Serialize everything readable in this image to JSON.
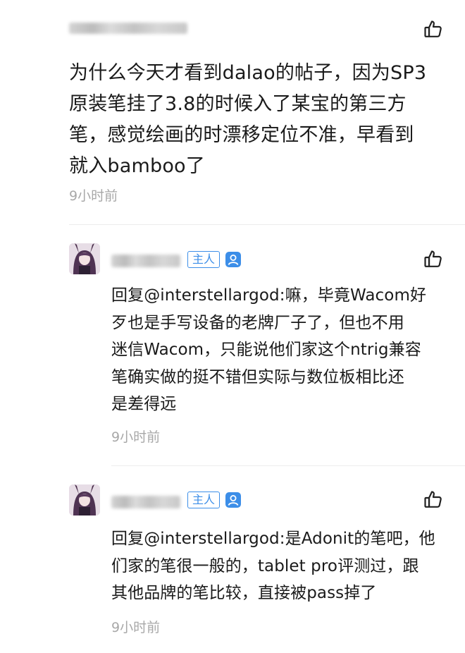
{
  "comments": [
    {
      "author_masked": true,
      "text": "为什么今天才看到dalao的帖子，因为SP3\n原装笔挂了3.8的时候入了某宝的第三方\n笔，感觉绘画的时漂移定位不准，早看到\n就入bamboo了",
      "time": "9小时前",
      "icon": "thumbs-up-icon"
    }
  ],
  "replies": [
    {
      "author_masked": true,
      "badge": "主人",
      "badge_color": "#3c8ee8",
      "verified_icon": "verified-icon",
      "text": "回复@interstellargod:嘛，毕竟Wacom好\n歹也是手写设备的老牌厂子了，但也不用\n迷信Wacom，只能说他们家这个ntrig兼容\n笔确实做的挺不错但实际与数位板相比还\n是差得远",
      "time": "9小时前",
      "icon": "thumbs-up-icon"
    },
    {
      "author_masked": true,
      "badge": "主人",
      "badge_color": "#3c8ee8",
      "verified_icon": "verified-icon",
      "text": "回复@interstellargod:是Adonit的笔吧，他\n们家的笔很一般的，tablet pro评测过，跟\n其他品牌的笔比较，直接被pass掉了",
      "time": "9小时前",
      "icon": "thumbs-up-icon"
    }
  ],
  "colors": {
    "accent": "#3c8ee8",
    "time_text": "#a8a8a8",
    "divider": "#ececec"
  }
}
